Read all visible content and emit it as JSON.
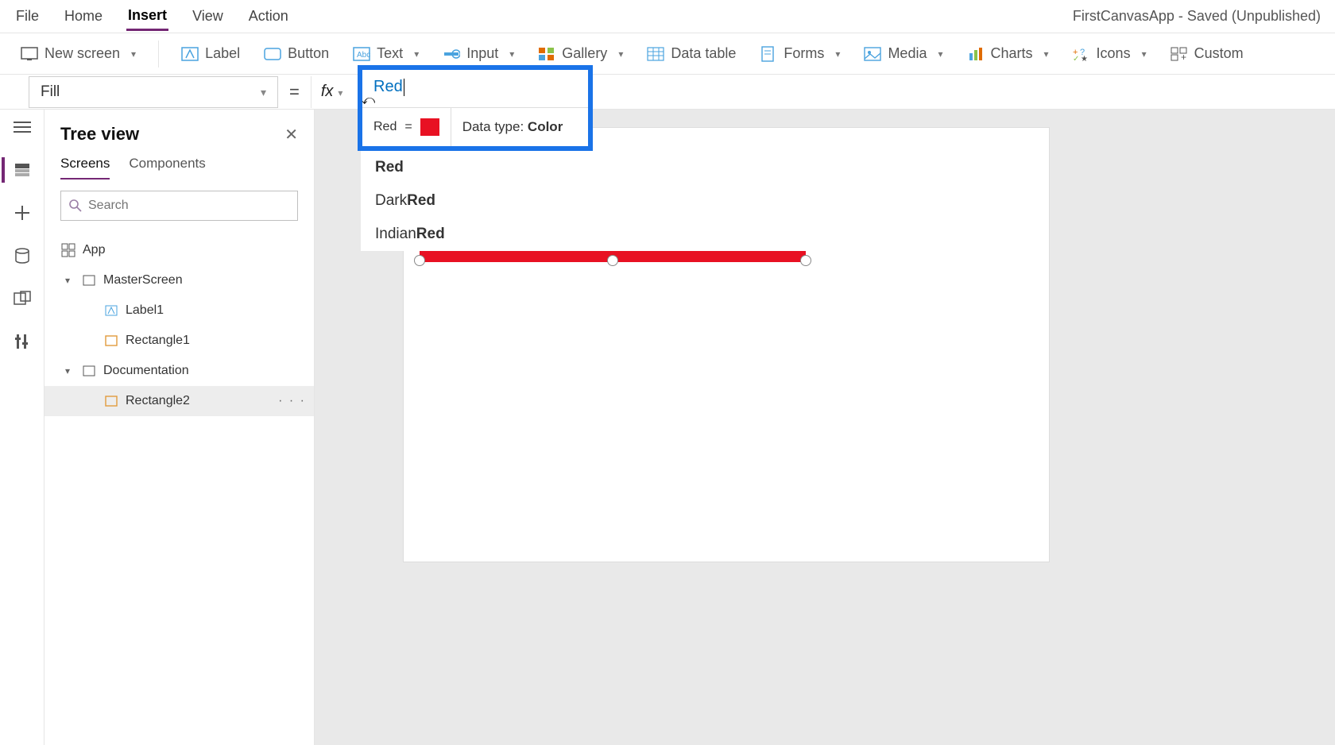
{
  "app_title": "FirstCanvasApp - Saved (Unpublished)",
  "menu": {
    "file": "File",
    "home": "Home",
    "insert": "Insert",
    "view": "View",
    "action": "Action",
    "active": "Insert"
  },
  "ribbon": {
    "new_screen": "New screen",
    "label": "Label",
    "button": "Button",
    "text": "Text",
    "input": "Input",
    "gallery": "Gallery",
    "data_table": "Data table",
    "forms": "Forms",
    "media": "Media",
    "charts": "Charts",
    "icons": "Icons",
    "custom": "Custom"
  },
  "formula": {
    "property": "Fill",
    "value": "Red",
    "preview_name": "Red",
    "preview_eq": "=",
    "data_type_label": "Data type: ",
    "data_type": "Color",
    "swatch": "#e81123"
  },
  "autocomplete": [
    {
      "prefix": "",
      "match": "Red"
    },
    {
      "prefix": "Dark",
      "match": "Red"
    },
    {
      "prefix": "Indian",
      "match": "Red"
    }
  ],
  "tree": {
    "title": "Tree view",
    "tabs": {
      "screens": "Screens",
      "components": "Components",
      "active": "Screens"
    },
    "search_placeholder": "Search",
    "nodes": {
      "app": "App",
      "master": "MasterScreen",
      "label1": "Label1",
      "rect1": "Rectangle1",
      "doc": "Documentation",
      "rect2": "Rectangle2"
    },
    "selected": "Rectangle2",
    "more": "· · ·"
  },
  "fx_label": "fx"
}
